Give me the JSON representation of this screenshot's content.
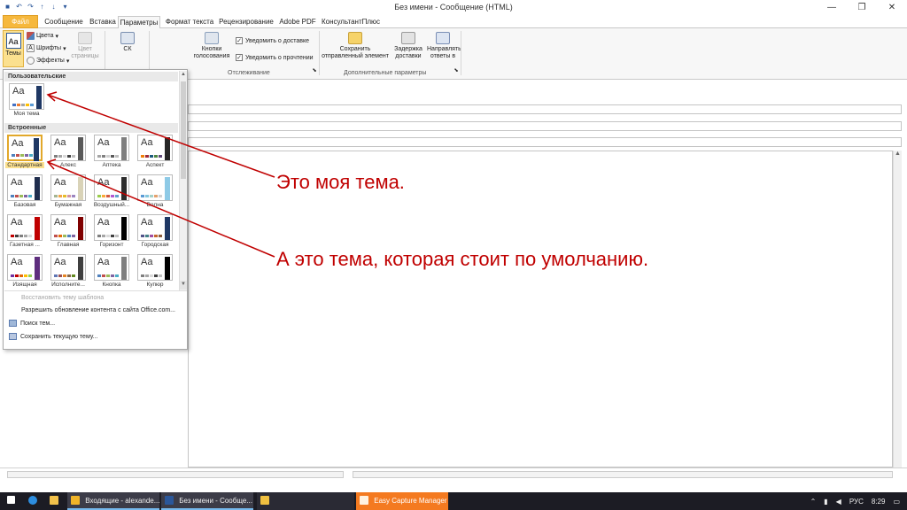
{
  "window": {
    "title": "Без имени - Сообщение (HTML)",
    "controls": {
      "minimize": "—",
      "restore": "❐",
      "close": "✕"
    }
  },
  "qat": [
    "save-icon",
    "undo-icon",
    "redo-icon",
    "up-icon",
    "down-icon",
    "customize-icon"
  ],
  "tabs": [
    {
      "label": "Файл"
    },
    {
      "label": "Сообщение"
    },
    {
      "label": "Вставка"
    },
    {
      "label": "Параметры"
    },
    {
      "label": "Формат текста"
    },
    {
      "label": "Рецензирование"
    },
    {
      "label": "Adobe PDF"
    },
    {
      "label": "КонсультантПлюс"
    }
  ],
  "ribbon": {
    "themes_label": "Темы",
    "themes_aa": "Aa",
    "colors_label": "Цвета",
    "fonts_label": "Шрифты",
    "effects_label": "Эффекты",
    "page_color_label": "Цвет страницы",
    "sk_label": "СК",
    "voting_label": "Кнопки голосования",
    "delivery_label": "Уведомить о доставке",
    "read_label": "Уведомить о прочтении",
    "tracking_group": "Отслеживание",
    "save_sent_label": "Сохранить отправленный элемент",
    "delay_label": "Задержка доставки",
    "direct_label": "Направлять ответы в",
    "more_options_group": "Дополнительные параметры",
    "check": "✓",
    "dropdown_arrow": "▾",
    "launcher": "⬊"
  },
  "dropdown": {
    "custom_header": "Пользовательские",
    "builtin_header": "Встроенные",
    "custom_themes": [
      {
        "name": "Моя тема",
        "stripe": "#1f3864",
        "dots": [
          "#4472c4",
          "#ed7d31",
          "#a5a5a5",
          "#ffc000",
          "#5b9bd5"
        ]
      }
    ],
    "builtin_themes": [
      {
        "name": "Стандартная",
        "stripe": "#1f3864",
        "dots": [
          "#4f81bd",
          "#c0504d",
          "#9bbb59",
          "#8064a2",
          "#4bacc6"
        ],
        "selected": true
      },
      {
        "name": "Алекс",
        "stripe": "#595959",
        "dots": [
          "#7f7f7f",
          "#a5a5a5",
          "#d9d9d9",
          "#404040",
          "#bfbfbf"
        ]
      },
      {
        "name": "Аптека",
        "stripe": "#7f7f7f",
        "dots": [
          "#a5a5a5",
          "#7f7f7f",
          "#d0d0d0",
          "#595959",
          "#bfbfbf"
        ]
      },
      {
        "name": "Аспект",
        "stripe": "#262626",
        "dots": [
          "#f07f09",
          "#9f2936",
          "#1b587c",
          "#4e8542",
          "#604878"
        ]
      },
      {
        "name": "Базовая",
        "stripe": "#1f2d4d",
        "dots": [
          "#4f81bd",
          "#c0504d",
          "#9bbb59",
          "#8064a2",
          "#4bacc6"
        ]
      },
      {
        "name": "Бумажная",
        "stripe": "#d9d3b8",
        "dots": [
          "#a5b592",
          "#f3a447",
          "#e7bc29",
          "#d092a7",
          "#9c85c0"
        ]
      },
      {
        "name": "Воздушный...",
        "stripe": "#2e2e2e",
        "dots": [
          "#9acd4c",
          "#faa93a",
          "#d35940",
          "#b258d3",
          "#63a0cc"
        ]
      },
      {
        "name": "Волна",
        "stripe": "#8ecae6",
        "dots": [
          "#5a9bd5",
          "#84c7dd",
          "#a5d1c9",
          "#e3a26e",
          "#d0d0d0"
        ]
      },
      {
        "name": "Газетная ...",
        "stripe": "#c00000",
        "dots": [
          "#c00000",
          "#404040",
          "#7f7f7f",
          "#a5a5a5",
          "#d9d9d9"
        ]
      },
      {
        "name": "Главная",
        "stripe": "#7f0000",
        "dots": [
          "#c0504d",
          "#e46c0a",
          "#9bbb59",
          "#4f81bd",
          "#8064a2"
        ]
      },
      {
        "name": "Горизонт",
        "stripe": "#000000",
        "dots": [
          "#7f7f7f",
          "#a5a5a5",
          "#d9d9d9",
          "#404040",
          "#bfbfbf"
        ]
      },
      {
        "name": "Городская",
        "stripe": "#1f3864",
        "dots": [
          "#53548a",
          "#438086",
          "#a04da3",
          "#c4652d",
          "#8b5d3d"
        ]
      },
      {
        "name": "Изящная",
        "stripe": "#5e2e7e",
        "dots": [
          "#7030a0",
          "#c00000",
          "#e46c0a",
          "#ffc000",
          "#92d050"
        ]
      },
      {
        "name": "Исполните...",
        "stripe": "#3f3f3f",
        "dots": [
          "#6076b4",
          "#9c5252",
          "#e68422",
          "#846648",
          "#63891f"
        ]
      },
      {
        "name": "Кнопка",
        "stripe": "#7f7f7f",
        "dots": [
          "#4f81bd",
          "#c0504d",
          "#9bbb59",
          "#8064a2",
          "#4bacc6"
        ]
      },
      {
        "name": "Купюр",
        "stripe": "#000000",
        "dots": [
          "#7f7f7f",
          "#a5a5a5",
          "#d9d9d9",
          "#404040",
          "#bfbfbf"
        ]
      }
    ],
    "menu": [
      {
        "label": "Восстановить тему шаблона",
        "disabled": true
      },
      {
        "label": "Разрешить обновление контента с сайта Office.com...",
        "disabled": false
      },
      {
        "label": "Поиск тем...",
        "disabled": false
      },
      {
        "label": "Сохранить текущую тему...",
        "disabled": false
      }
    ],
    "scroll_up": "▲",
    "scroll_down": "▼"
  },
  "annotations": {
    "my_theme": "Это моя тема.",
    "default_theme": "А это тема, которая стоит по умолчанию."
  },
  "editor_scroll": {
    "up": "▲",
    "down": "▼"
  },
  "taskbar": {
    "items": [
      {
        "label": "Входящие - alexande...",
        "color": "#f0b429"
      },
      {
        "label": "Без имени - Сообще...",
        "color": "#2b579a"
      },
      {
        "label": "",
        "color": "#f0c040"
      },
      {
        "label": "Easy Capture Manager",
        "color": "#f47a20"
      }
    ],
    "lang": "РУС",
    "time": "8:29"
  },
  "colors": {
    "accent_file": "#f6b83d",
    "annotation": "#c00000",
    "taskbar_bg": "#1c1c24"
  }
}
